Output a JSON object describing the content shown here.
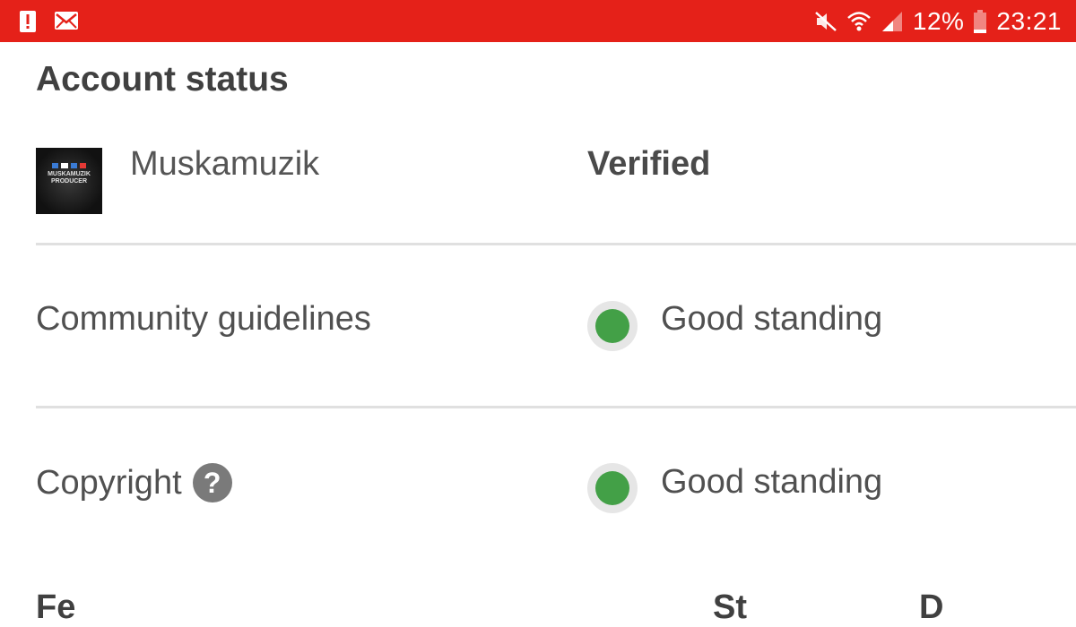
{
  "status_bar": {
    "background": "#e52119",
    "left_icons": [
      "alert-icon",
      "mail-icon"
    ],
    "right_icons": [
      "mute-icon",
      "wifi-icon",
      "signal-icon",
      "battery-icon"
    ],
    "battery_percent": "12%",
    "time": "23:21"
  },
  "page": {
    "title": "Account status",
    "channel": {
      "name": "Muskamuzik",
      "thumb_text": "MUSKAMUZIK PRODUCER",
      "status": "Verified"
    },
    "rows": [
      {
        "label": "Community guidelines",
        "status": "Good standing",
        "status_color": "#43a047"
      },
      {
        "label": "Copyright",
        "status": "Good standing",
        "status_color": "#43a047",
        "help_icon": "?"
      }
    ],
    "cutoff_headers": [
      "Fe",
      "St",
      "D"
    ]
  }
}
